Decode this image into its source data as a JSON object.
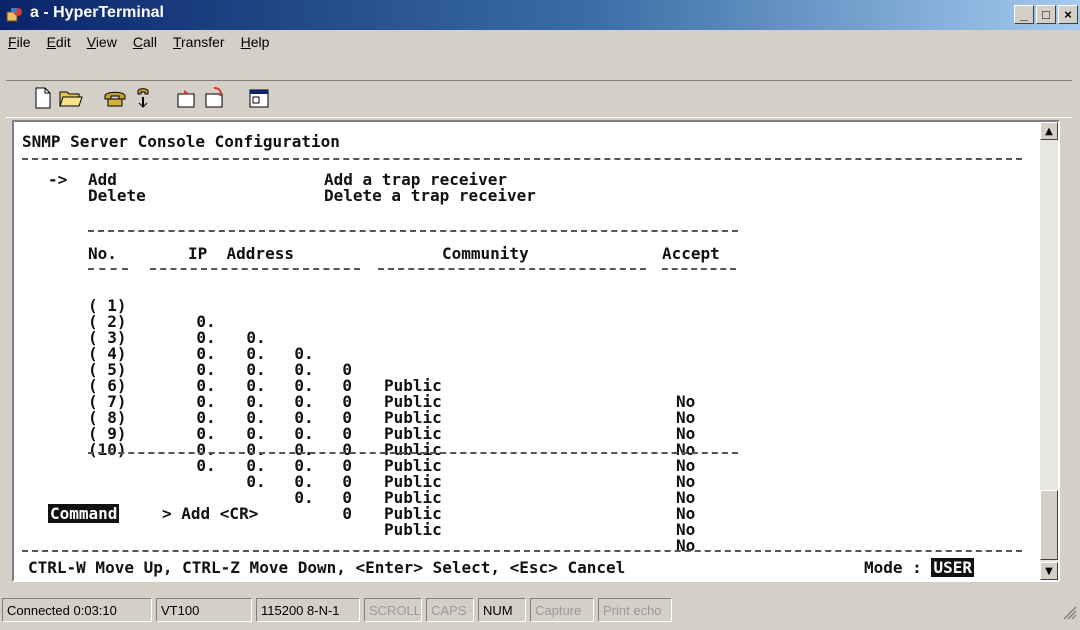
{
  "window": {
    "title": "a - HyperTerminal",
    "buttons": {
      "minimize": "_",
      "maximize": "□",
      "close": "×"
    }
  },
  "menu": {
    "items": [
      {
        "key": "F",
        "rest": "ile"
      },
      {
        "key": "E",
        "rest": "dit"
      },
      {
        "key": "V",
        "rest": "iew"
      },
      {
        "key": "C",
        "rest": "all"
      },
      {
        "key": "T",
        "rest": "ransfer"
      },
      {
        "key": "H",
        "rest": "elp"
      }
    ]
  },
  "toolbar": {
    "icons": [
      "new-icon",
      "open-icon",
      "phone-icon",
      "disconnect-icon",
      "send-icon",
      "receive-icon",
      "properties-icon"
    ]
  },
  "terminal": {
    "header": "SNMP Server Console Configuration",
    "menu": [
      {
        "pointer": "->",
        "label": "Add",
        "description": "Add a trap receiver"
      },
      {
        "pointer": "",
        "label": "Delete",
        "description": "Delete a trap receiver"
      }
    ],
    "table": {
      "headers": {
        "no": "No.",
        "ip": "IP  Address",
        "community": "Community",
        "accept": "Accept"
      },
      "rows": [
        {
          "no": "( 1)",
          "ip": [
            "0",
            "0",
            "0",
            "0"
          ],
          "community": "Public",
          "accept": "No"
        },
        {
          "no": "( 2)",
          "ip": [
            "0",
            "0",
            "0",
            "0"
          ],
          "community": "Public",
          "accept": "No"
        },
        {
          "no": "( 3)",
          "ip": [
            "0",
            "0",
            "0",
            "0"
          ],
          "community": "Public",
          "accept": "No"
        },
        {
          "no": "( 4)",
          "ip": [
            "0",
            "0",
            "0",
            "0"
          ],
          "community": "Public",
          "accept": "No"
        },
        {
          "no": "( 5)",
          "ip": [
            "0",
            "0",
            "0",
            "0"
          ],
          "community": "Public",
          "accept": "No"
        },
        {
          "no": "( 6)",
          "ip": [
            "0",
            "0",
            "0",
            "0"
          ],
          "community": "Public",
          "accept": "No"
        },
        {
          "no": "( 7)",
          "ip": [
            "0",
            "0",
            "0",
            "0"
          ],
          "community": "Public",
          "accept": "No"
        },
        {
          "no": "( 8)",
          "ip": [
            "0",
            "0",
            "0",
            "0"
          ],
          "community": "Public",
          "accept": "No"
        },
        {
          "no": "( 9)",
          "ip": [
            "0",
            "0",
            "0",
            "0"
          ],
          "community": "Public",
          "accept": "No"
        },
        {
          "no": "(10)",
          "ip": [
            "0",
            "0",
            "0",
            "0"
          ],
          "community": "Public",
          "accept": "No"
        }
      ]
    },
    "command_label": "Command",
    "command_text": "> Add <CR>",
    "footer_help": "CTRL-W Move Up, CTRL-Z Move Down, <Enter> Select, <Esc> Cancel",
    "mode_label": "Mode :",
    "mode_value": "USER"
  },
  "statusbar": {
    "connected": "Connected 0:03:10",
    "emulation": "VT100",
    "port_settings": "115200 8-N-1",
    "scroll": "SCROLL",
    "caps": "CAPS",
    "num": "NUM",
    "capture": "Capture",
    "print_echo": "Print echo"
  }
}
